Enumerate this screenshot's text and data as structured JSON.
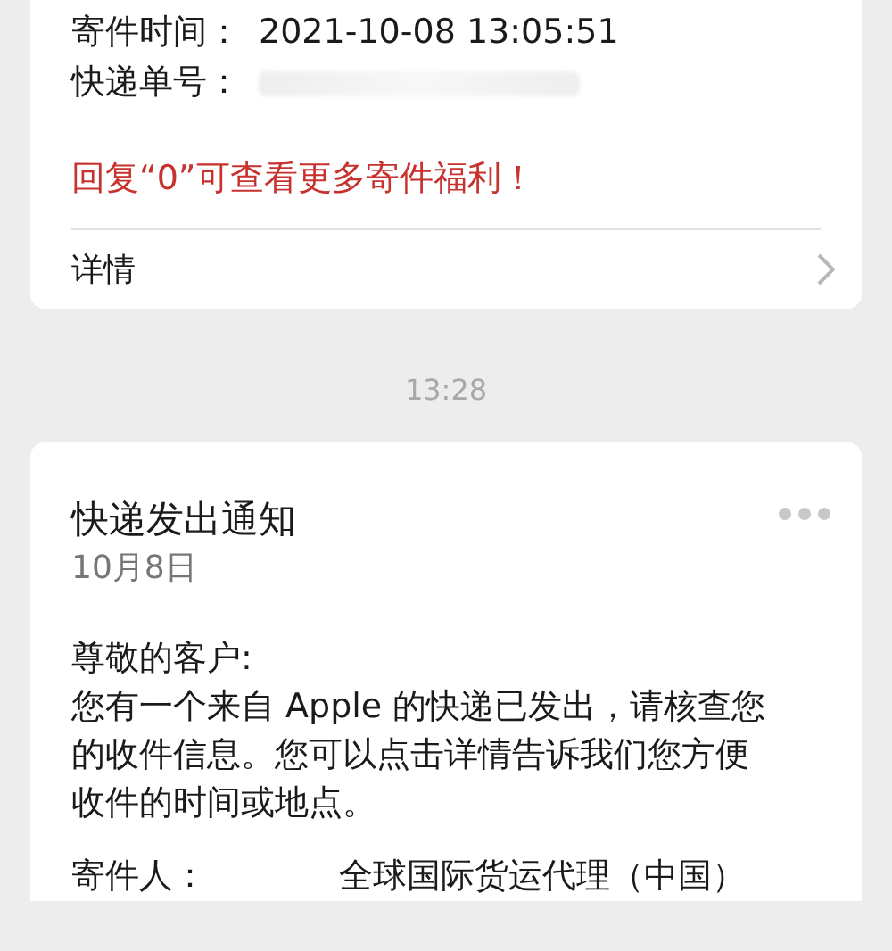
{
  "cards": [
    {
      "fields": [
        {
          "label": "寄件时间：",
          "value": "2021-10-08 13:05:51",
          "redacted": false
        },
        {
          "label": "快递单号：",
          "redacted": true
        }
      ],
      "promo": "回复“0”可查看更多寄件福利！",
      "details_link": "详情"
    }
  ],
  "timestamp": "13:28",
  "notice": {
    "title": "快递发出通知",
    "date": "10月8日",
    "greeting": "尊敬的客户:",
    "body": "您有一个来自 Apple 的快递已发出，请核查您的收件信息。您可以点击详情告诉我们您方便收件的时间或地点。",
    "fields": [
      {
        "label": "寄件人：",
        "value": "全球国际货运代理（中国）"
      }
    ]
  }
}
